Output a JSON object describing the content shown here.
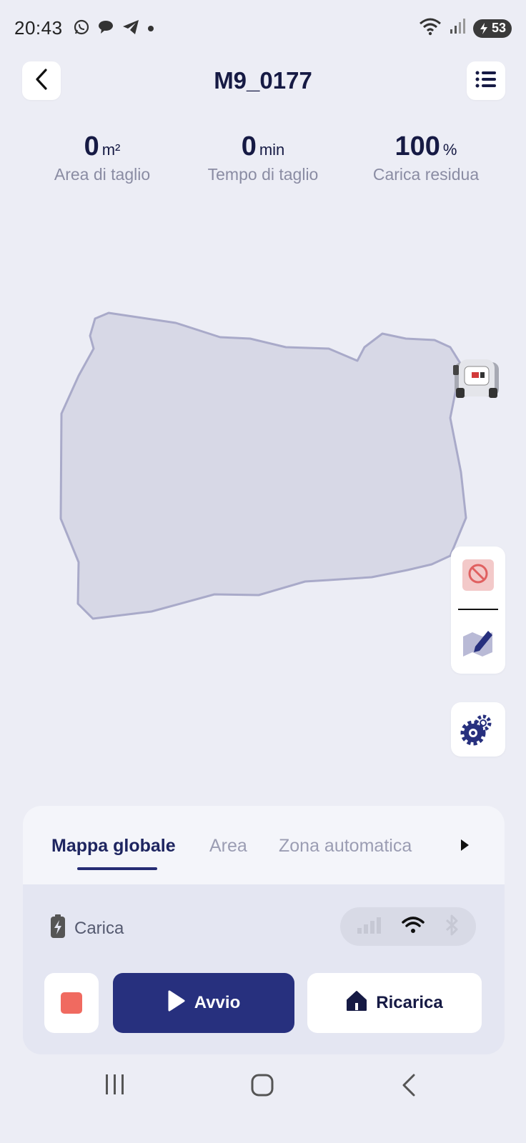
{
  "status_bar": {
    "time": "20:43",
    "battery_level": "53",
    "left_icons": [
      "whatsapp-icon",
      "chat-bubble-icon",
      "telegram-icon",
      "dot-icon"
    ],
    "right_icons": [
      "wifi-icon",
      "signal-icon",
      "battery-icon"
    ]
  },
  "header": {
    "title": "M9_0177",
    "back_icon": "chevron-left-icon",
    "menu_icon": "list-icon"
  },
  "stats": [
    {
      "value": "0",
      "unit": "m²",
      "label": "Area di taglio"
    },
    {
      "value": "0",
      "unit": "min",
      "label": "Tempo di taglio"
    },
    {
      "value": "100",
      "unit": "%",
      "label": "Carica residua"
    }
  ],
  "map": {
    "zone_fill": "#d7d8e6",
    "zone_stroke": "#a9aac9"
  },
  "tools": {
    "no_go_icon": "no-go-zone-icon",
    "edit_map_icon": "edit-map-icon",
    "settings_icon": "settings-gears-icon"
  },
  "panel": {
    "tabs": [
      {
        "label": "Mappa globale",
        "active": true
      },
      {
        "label": "Area",
        "active": false
      },
      {
        "label": "Zona automatica",
        "active": false
      }
    ],
    "more_icon": "play-arrow-icon",
    "status_label": "Carica",
    "status_icon": "charging-battery-icon",
    "connectivity": {
      "cellular": "inactive",
      "wifi": "active",
      "bluetooth": "inactive"
    },
    "start_label": "Avvio",
    "recharge_label": "Ricarica"
  },
  "colors": {
    "accent": "#27307e",
    "stop": "#f06a60",
    "background": "#ecedf5"
  }
}
